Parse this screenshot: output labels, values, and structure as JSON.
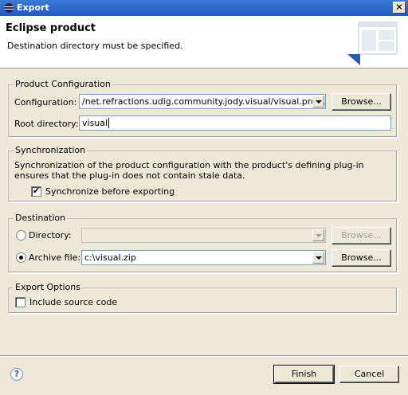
{
  "window": {
    "title": "Export"
  },
  "header": {
    "title": "Eclipse product",
    "message": "Destination directory must be specified."
  },
  "product_config": {
    "legend": "Product Configuration",
    "configuration_label": "Configuration:",
    "configuration_value": "/net.refractions.udig.community.jody.visual/visual.product",
    "browse_label": "Browse...",
    "root_label": "Root directory:",
    "root_value": "visual"
  },
  "synchronization": {
    "legend": "Synchronization",
    "description": "Synchronization of the product configuration with the product's defining plug-in ensures that the plug-in does not contain stale data.",
    "checkbox_label": "Synchronize before exporting",
    "checked": true
  },
  "destination": {
    "legend": "Destination",
    "directory_label": "Directory:",
    "directory_value": "",
    "directory_browse": "Browse...",
    "archive_label": "Archive file:",
    "archive_value": "c:\\visual.zip",
    "archive_browse": "Browse...",
    "selected": "archive"
  },
  "export_options": {
    "legend": "Export Options",
    "include_source_label": "Include source code",
    "checked": false
  },
  "footer": {
    "finish_label": "Finish",
    "cancel_label": "Cancel"
  }
}
